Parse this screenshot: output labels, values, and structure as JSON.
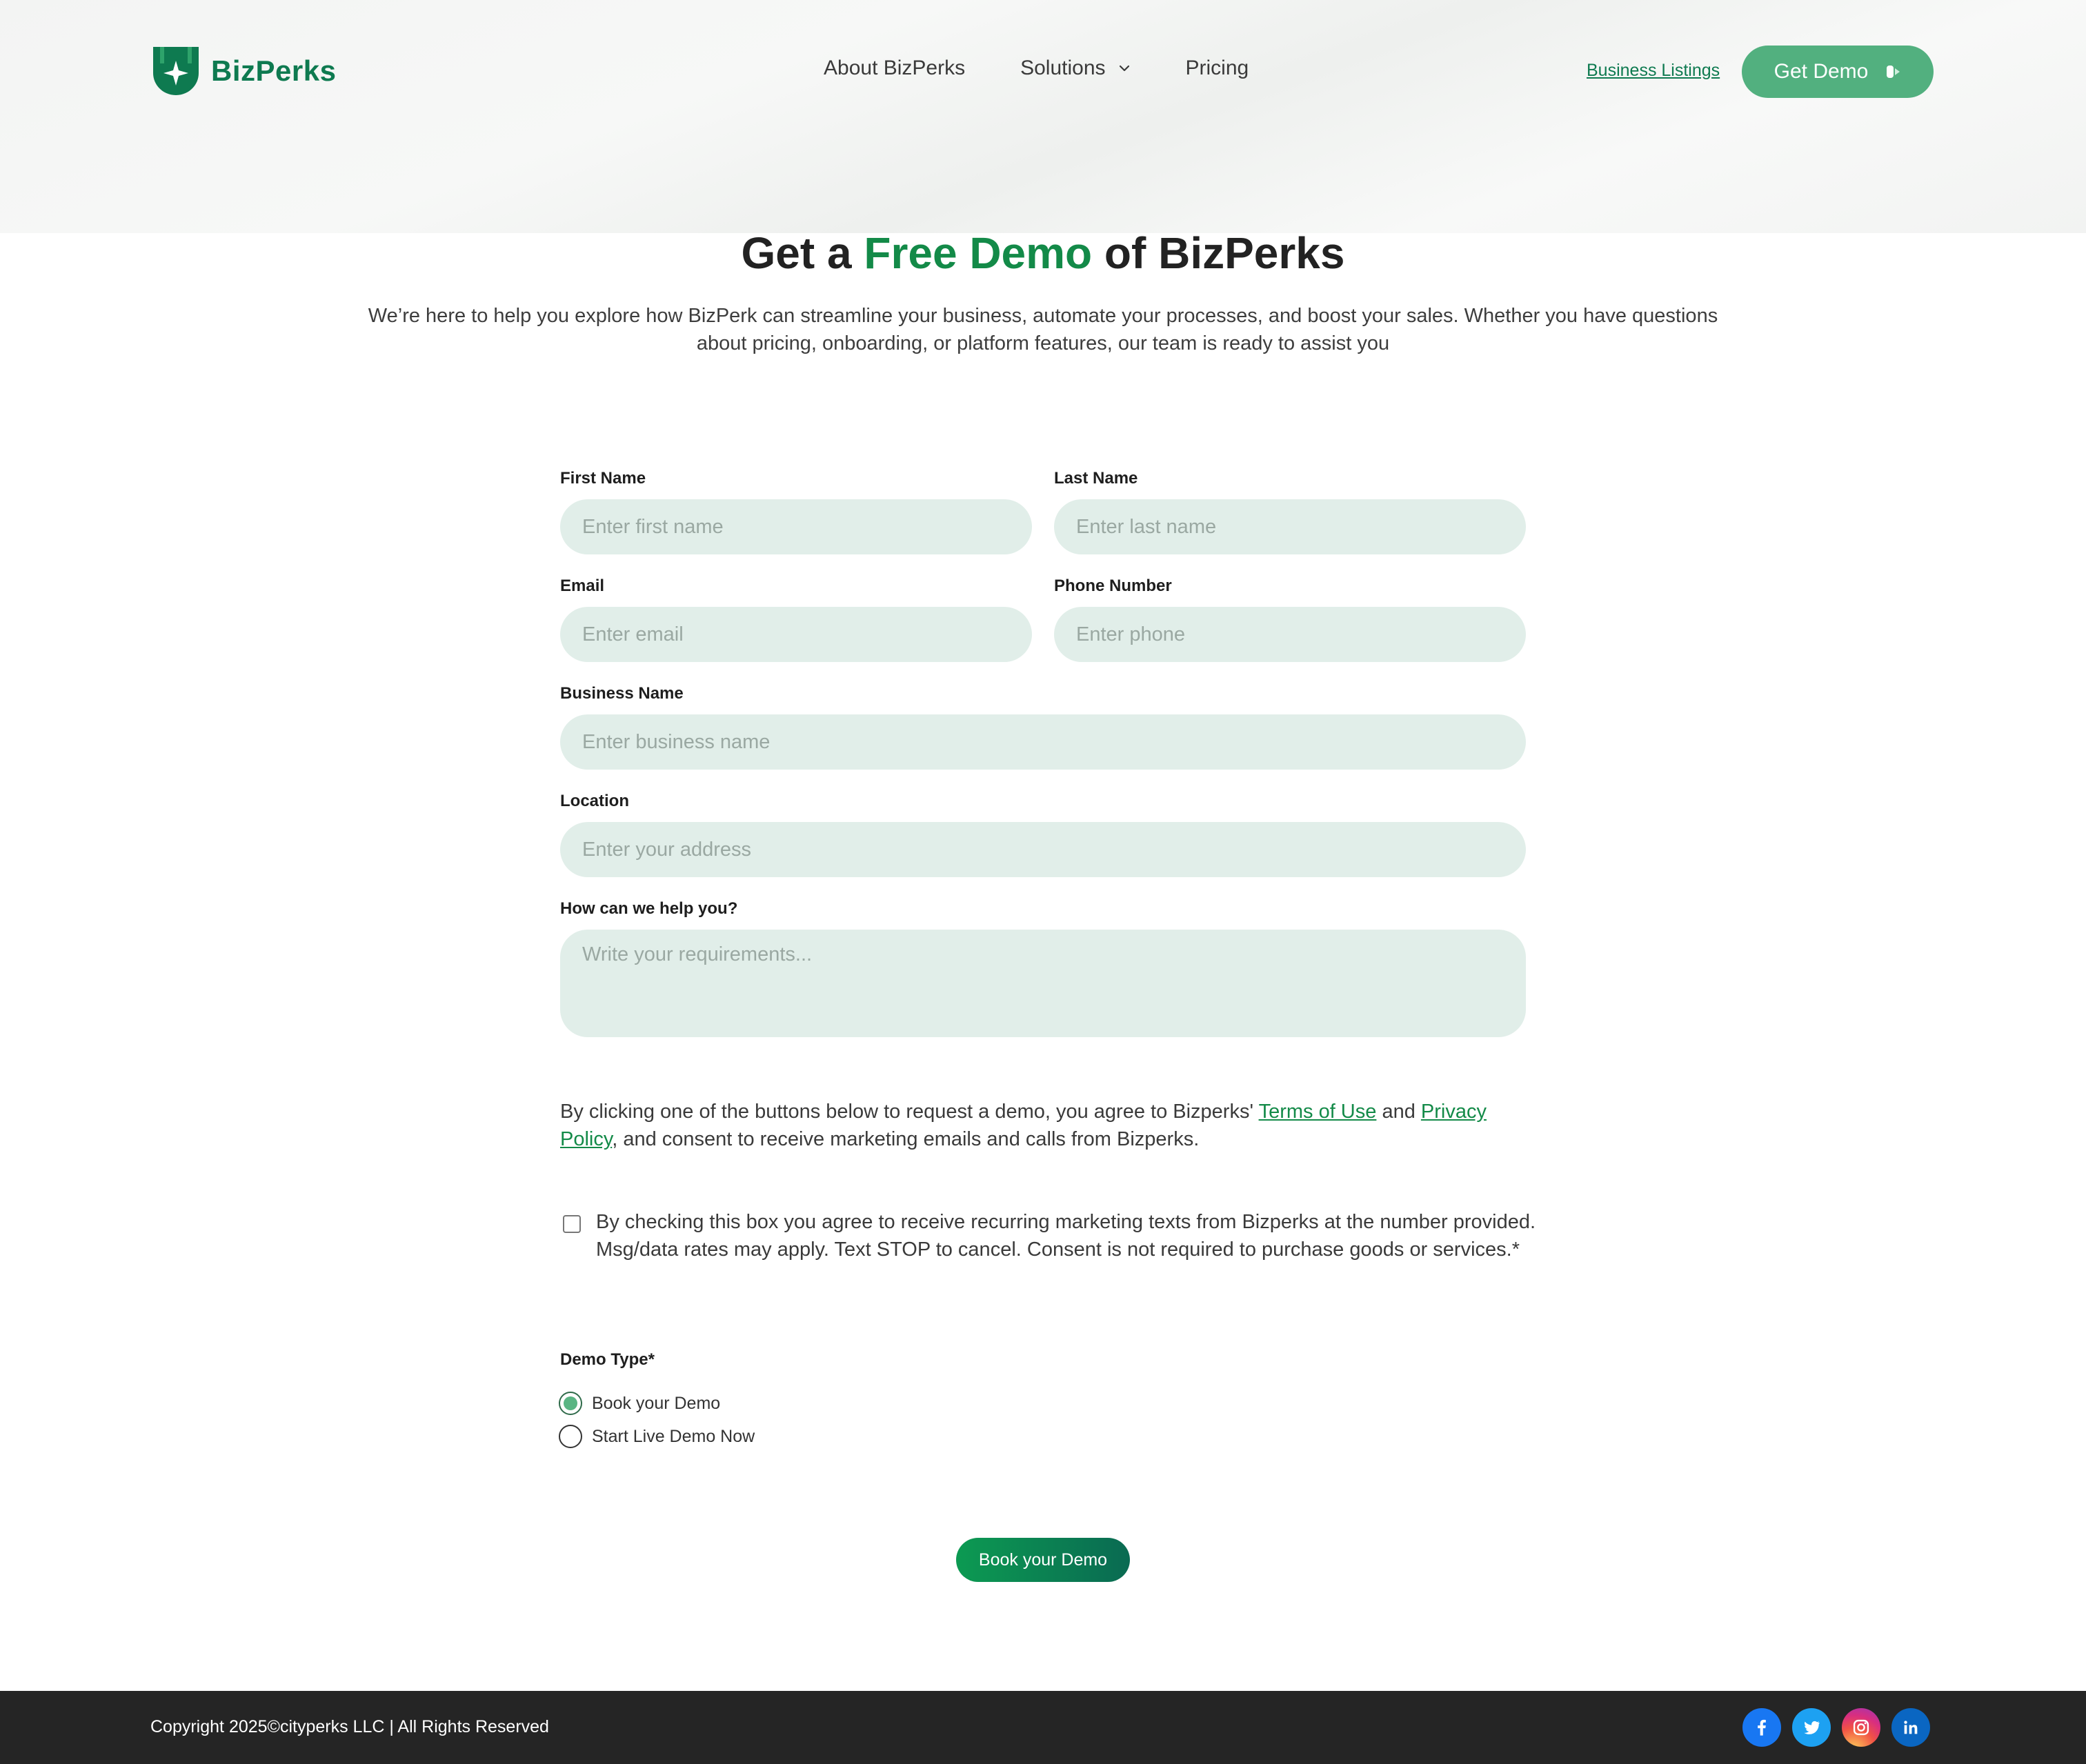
{
  "brand": {
    "name": "BizPerks",
    "color": "#0e7a50",
    "accent": "#138a48",
    "button_green": "#52b07f"
  },
  "nav": {
    "links": [
      {
        "label": "About BizPerks"
      },
      {
        "label": "Solutions"
      },
      {
        "label": "Pricing"
      }
    ],
    "business_listings": "Business Listings",
    "get_demo": "Get Demo"
  },
  "hero": {
    "title_prefix": "Get a",
    "title_accent": "Free Demo",
    "title_suffix": "of BizPerks",
    "subtitle": "We’re here to help you explore how BizPerk can streamline your business, automate your processes, and boost your sales. Whether you have questions about pricing, onboarding, or platform features, our team is ready to assist you"
  },
  "form": {
    "first_name": {
      "label": "First Name",
      "placeholder": "Enter first name"
    },
    "last_name": {
      "label": "Last Name",
      "placeholder": "Enter last name"
    },
    "email": {
      "label": "Email",
      "placeholder": "Enter email"
    },
    "phone": {
      "label": "Phone Number",
      "placeholder": "Enter phone"
    },
    "business_name": {
      "label": "Business Name",
      "placeholder": "Enter business name"
    },
    "location": {
      "label": "Location",
      "placeholder": "Enter your address"
    },
    "help": {
      "label": "How can we help you?",
      "placeholder": "Write your requirements..."
    }
  },
  "consent": {
    "pre": "By clicking one of the buttons below to request a demo, you agree to Bizperks'",
    "terms": "Terms of Use",
    "and": "and",
    "privacy": "Privacy Policy",
    "post": ", and consent to receive marketing emails and calls from Bizperks."
  },
  "sms_consent": {
    "checked": false,
    "text": "By checking this box you agree to receive recurring marketing texts from Bizperks at the number provided. Msg/data rates may apply. Text STOP to cancel. Consent is not required to purchase goods or services.*"
  },
  "demo_type": {
    "label": "Demo Type*",
    "options": [
      {
        "label": "Book your Demo",
        "selected": true
      },
      {
        "label": "Start Live Demo Now",
        "selected": false
      }
    ]
  },
  "submit_label": "Book your Demo",
  "footer": {
    "copyright": "Copyright 2025©cityperks LLC | All Rights Reserved",
    "socials": [
      "facebook-icon",
      "twitter-icon",
      "instagram-icon",
      "linkedin-icon"
    ]
  }
}
